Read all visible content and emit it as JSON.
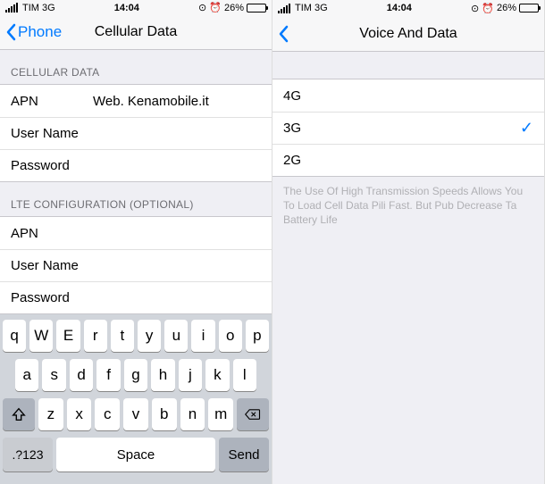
{
  "left": {
    "status": {
      "carrier": "TIM",
      "net": "3G",
      "time": "14:04",
      "battery_pct": "26%"
    },
    "nav": {
      "back": "Phone",
      "title": "Cellular Data"
    },
    "section1": {
      "header": "CELLULAR DATA",
      "apn_label": "APN",
      "apn_value": "Web. Kenamobile.it",
      "user_label": "User Name",
      "user_value": "",
      "pass_label": "Password",
      "pass_value": ""
    },
    "section2": {
      "header": "LTE CONFIGURATION (OPTIONAL)",
      "apn_label": "APN",
      "apn_value": "",
      "user_label": "User Name",
      "user_value": "",
      "pass_label": "Password",
      "pass_value": ""
    },
    "keyboard": {
      "row1": [
        "q",
        "W",
        "E",
        "r",
        "t",
        "y",
        "u",
        "i",
        "o",
        "p"
      ],
      "row2": [
        "a",
        "s",
        "d",
        "f",
        "g",
        "h",
        "j",
        "k",
        "l"
      ],
      "row3": [
        "z",
        "x",
        "c",
        "v",
        "b",
        "n",
        "m"
      ],
      "numkey": ".?123",
      "space": "Space",
      "send": "Send"
    }
  },
  "right": {
    "status": {
      "carrier": "TIM",
      "net": "3G",
      "time": "14:04",
      "battery_pct": "26%"
    },
    "nav": {
      "back": "",
      "title": "Voice And Data"
    },
    "options": [
      {
        "label": "4G",
        "selected": false
      },
      {
        "label": "3G",
        "selected": true
      },
      {
        "label": "2G",
        "selected": false
      }
    ],
    "footnote": "The Use Of High Transmission Speeds Allows You To Load Cell Data Pili Fast. But Pub Decrease Ta Battery Life"
  }
}
